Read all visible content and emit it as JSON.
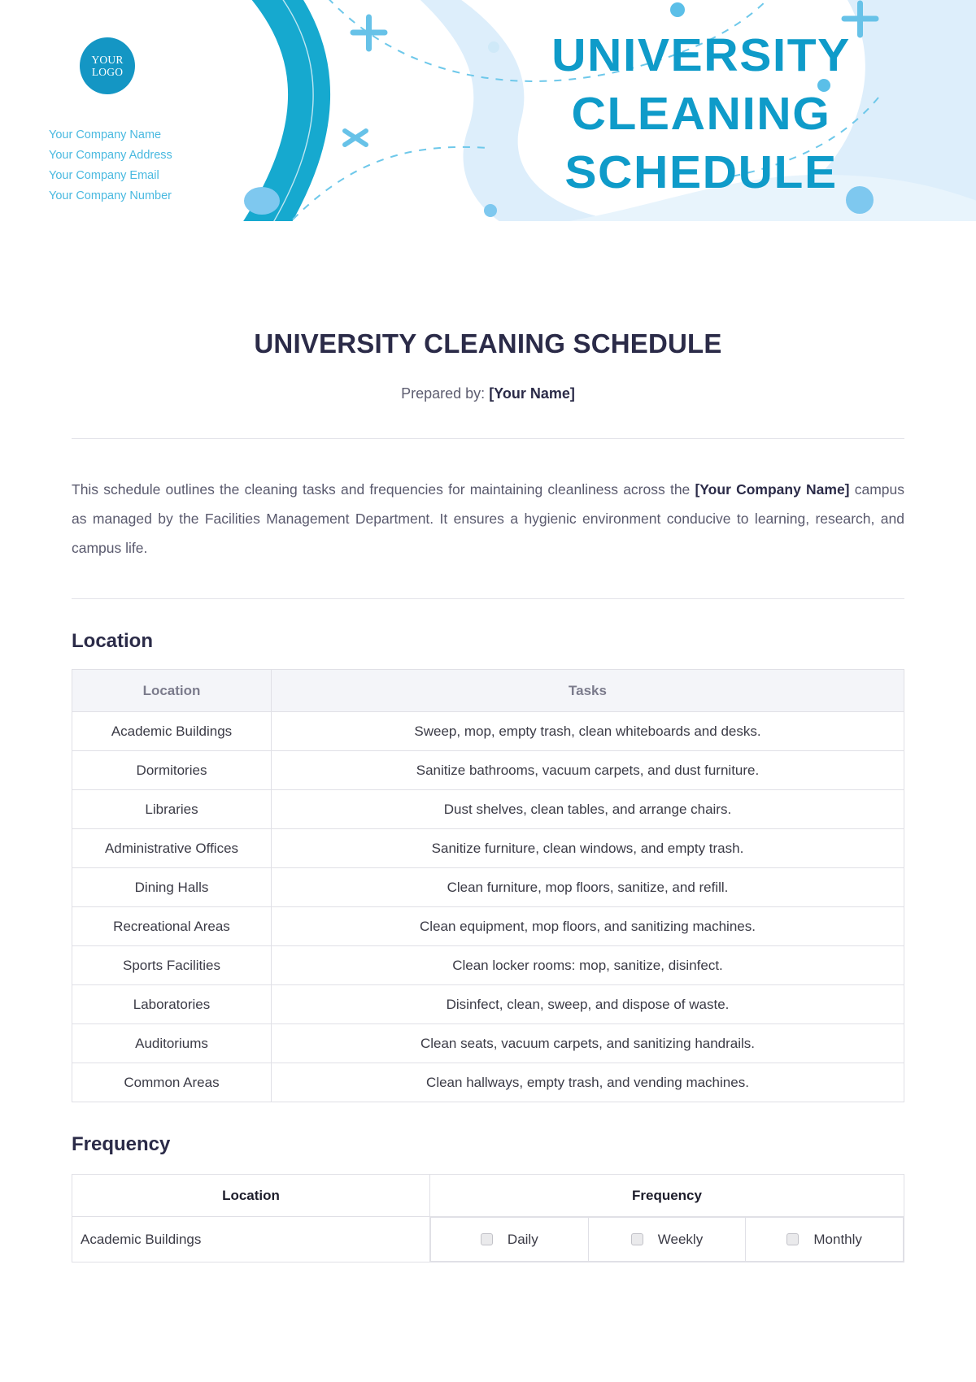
{
  "banner": {
    "logo_line1": "YOUR",
    "logo_line2": "LOGO",
    "company": [
      "Your Company Name",
      "Your Company Address",
      "Your Company Email",
      "Your Company Number"
    ],
    "title": "UNIVERSITY CLEANING SCHEDULE",
    "colors": {
      "brand_teal": "#0f9bc9",
      "logo_blue": "#1496c4",
      "company_text": "#49b9e0",
      "pale_blue": "#ddeefb",
      "dot_blue": "#7ec8ef"
    }
  },
  "document": {
    "title": "UNIVERSITY CLEANING SCHEDULE",
    "prepared_label": "Prepared by:",
    "prepared_value": "[Your Name]",
    "intro_part1": "This schedule outlines the cleaning tasks and frequencies for maintaining cleanliness across the ",
    "intro_company": "[Your Company Name]",
    "intro_part2": " campus as managed by the Facilities Management Department. It ensures a hygienic environment conducive to learning, research, and campus life."
  },
  "location_section": {
    "heading": "Location",
    "columns": [
      "Location",
      "Tasks"
    ],
    "rows": [
      [
        "Academic Buildings",
        "Sweep, mop, empty trash, clean whiteboards and desks."
      ],
      [
        "Dormitories",
        "Sanitize bathrooms, vacuum carpets, and dust furniture."
      ],
      [
        "Libraries",
        "Dust shelves, clean tables, and arrange chairs."
      ],
      [
        "Administrative Offices",
        "Sanitize furniture, clean windows, and empty trash."
      ],
      [
        "Dining Halls",
        "Clean furniture, mop floors, sanitize, and refill."
      ],
      [
        "Recreational Areas",
        "Clean equipment, mop floors, and sanitizing machines."
      ],
      [
        "Sports Facilities",
        "Clean locker rooms: mop, sanitize, disinfect."
      ],
      [
        "Laboratories",
        "Disinfect, clean, sweep, and dispose of waste."
      ],
      [
        "Auditoriums",
        "Clean seats, vacuum carpets, and sanitizing handrails."
      ],
      [
        "Common Areas",
        "Clean hallways, empty trash, and vending machines."
      ]
    ]
  },
  "frequency_section": {
    "heading": "Frequency",
    "columns": [
      "Location",
      "Frequency"
    ],
    "options": [
      "Daily",
      "Weekly",
      "Monthly"
    ],
    "rows": [
      {
        "location": "Academic Buildings",
        "daily": false,
        "weekly": false,
        "monthly": false
      }
    ]
  }
}
